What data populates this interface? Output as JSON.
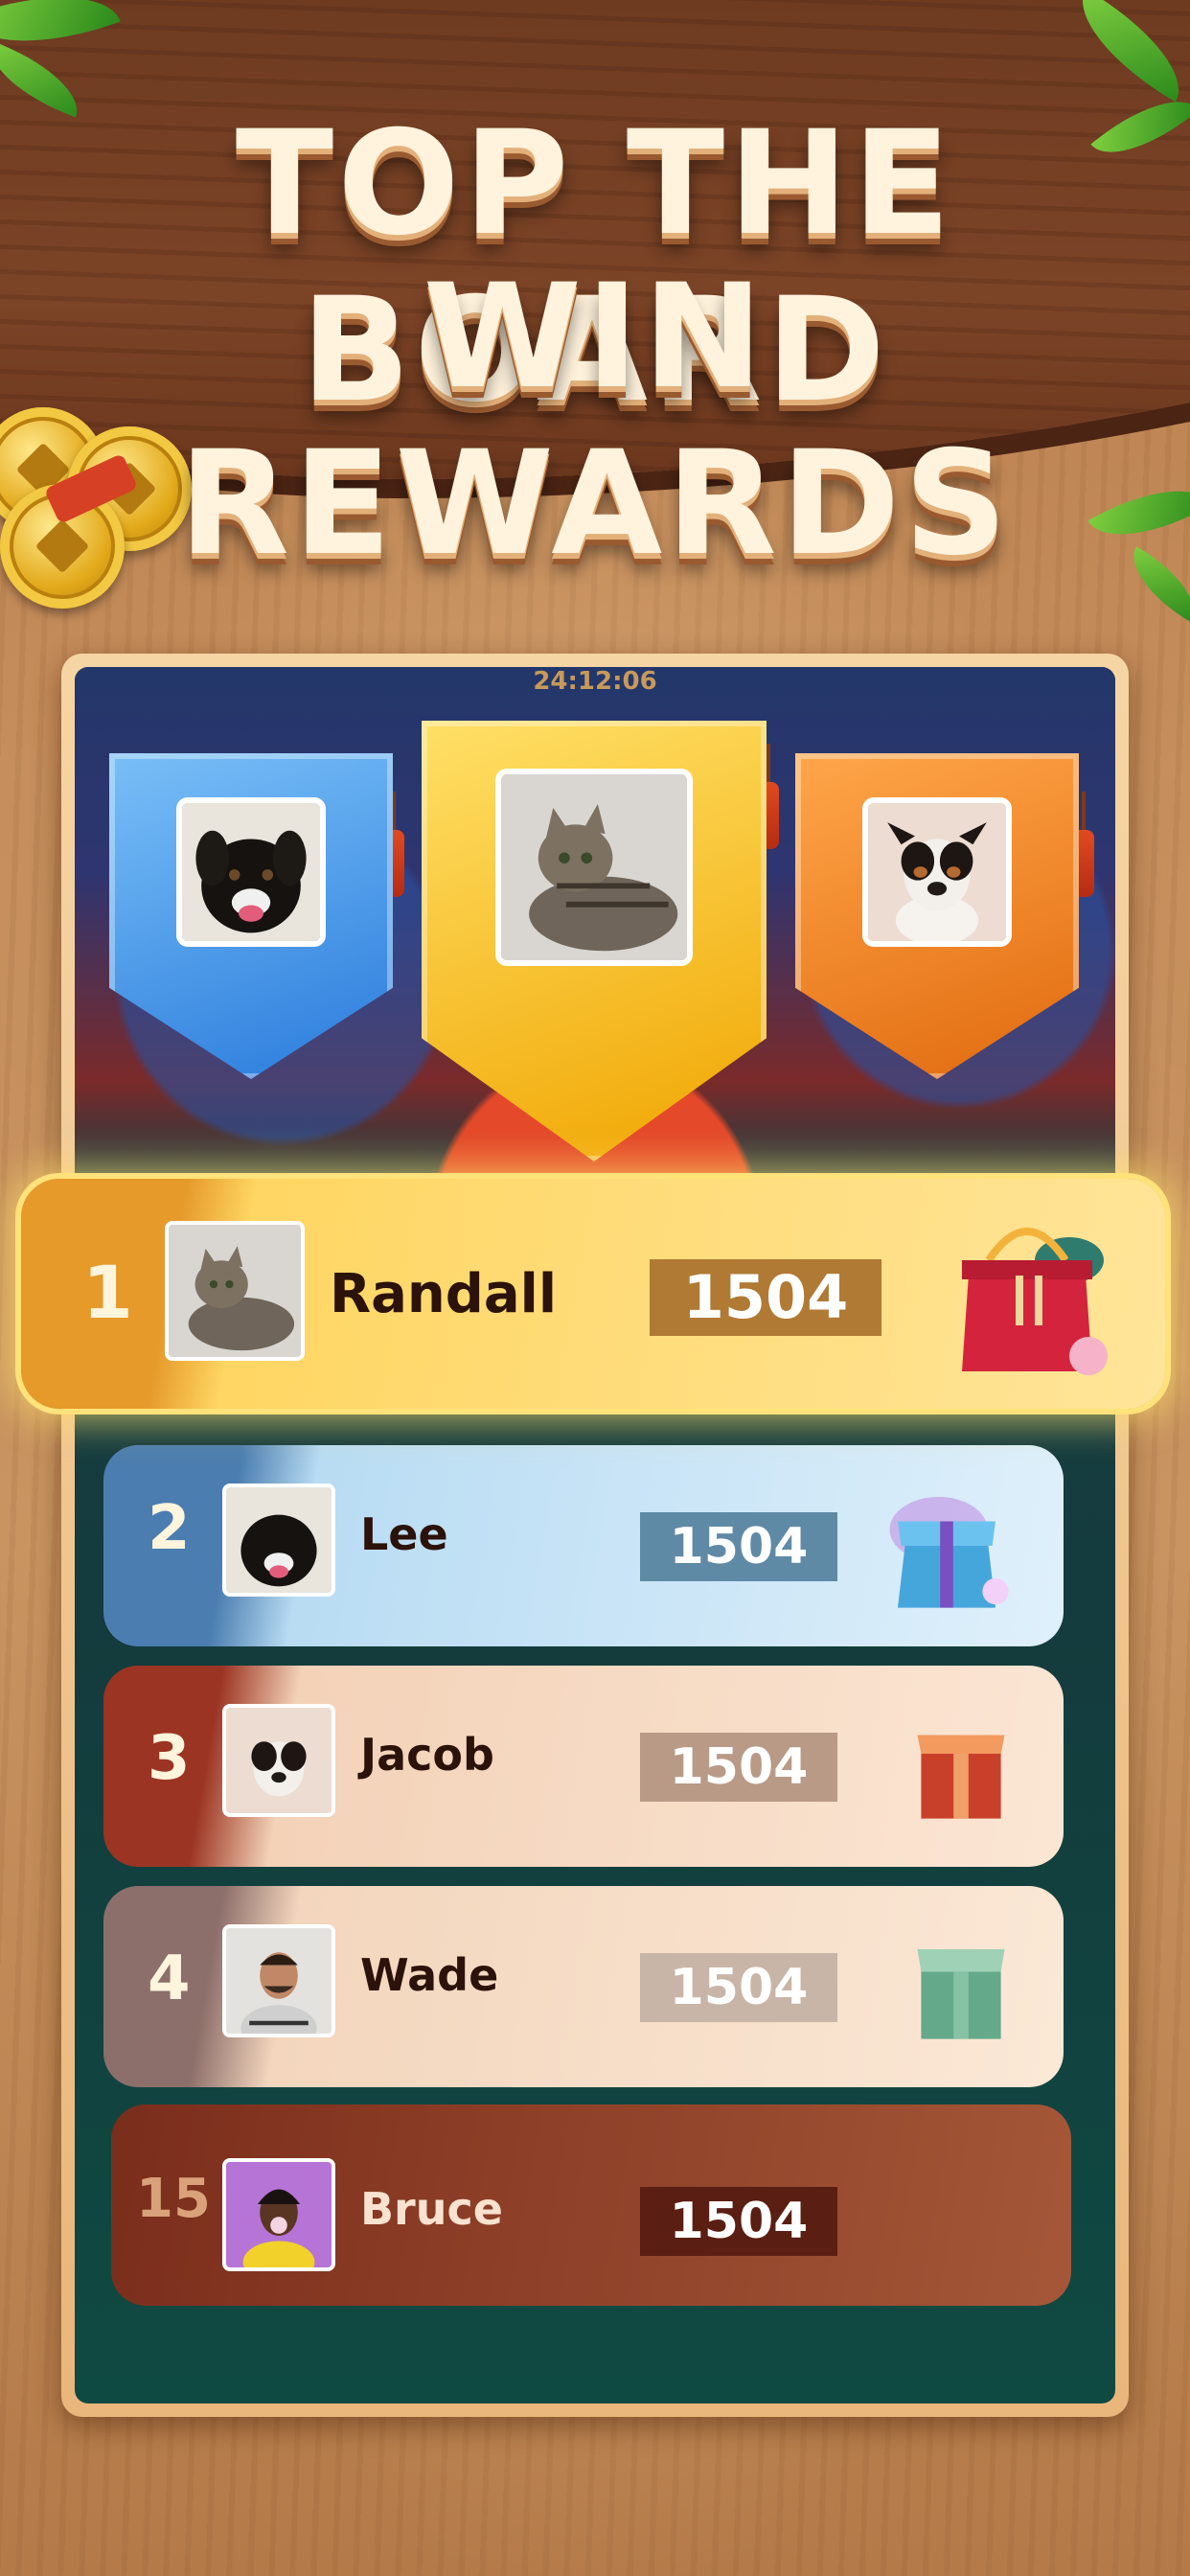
{
  "headline": {
    "line1": "TOP THE BOARD",
    "line2": "WIN REWARDS"
  },
  "board": {
    "timer": "24:12:06"
  },
  "podium": [
    {
      "place": "second",
      "avatar": "black-dog",
      "color": "#4a9be8"
    },
    {
      "place": "first",
      "avatar": "tabby-cat",
      "color": "#f6c21f"
    },
    {
      "place": "third",
      "avatar": "terrier-dog",
      "color": "#ee7a1c"
    }
  ],
  "rows": [
    {
      "rank": "1",
      "name": "Randall",
      "score": "1504",
      "avatar": "tabby-cat",
      "reward": "red-gift-bag-icon"
    },
    {
      "rank": "2",
      "name": "Lee",
      "score": "1504",
      "avatar": "black-dog",
      "reward": "blue-gift-box-icon"
    },
    {
      "rank": "3",
      "name": "Jacob",
      "score": "1504",
      "avatar": "terrier-dog",
      "reward": "red-gift-box-icon"
    },
    {
      "rank": "4",
      "name": "Wade",
      "score": "1504",
      "avatar": "man-photo",
      "reward": "green-gift-box-icon"
    },
    {
      "rank": "15",
      "name": "Bruce",
      "score": "1504",
      "avatar": "woman-photo",
      "reward": ""
    }
  ]
}
